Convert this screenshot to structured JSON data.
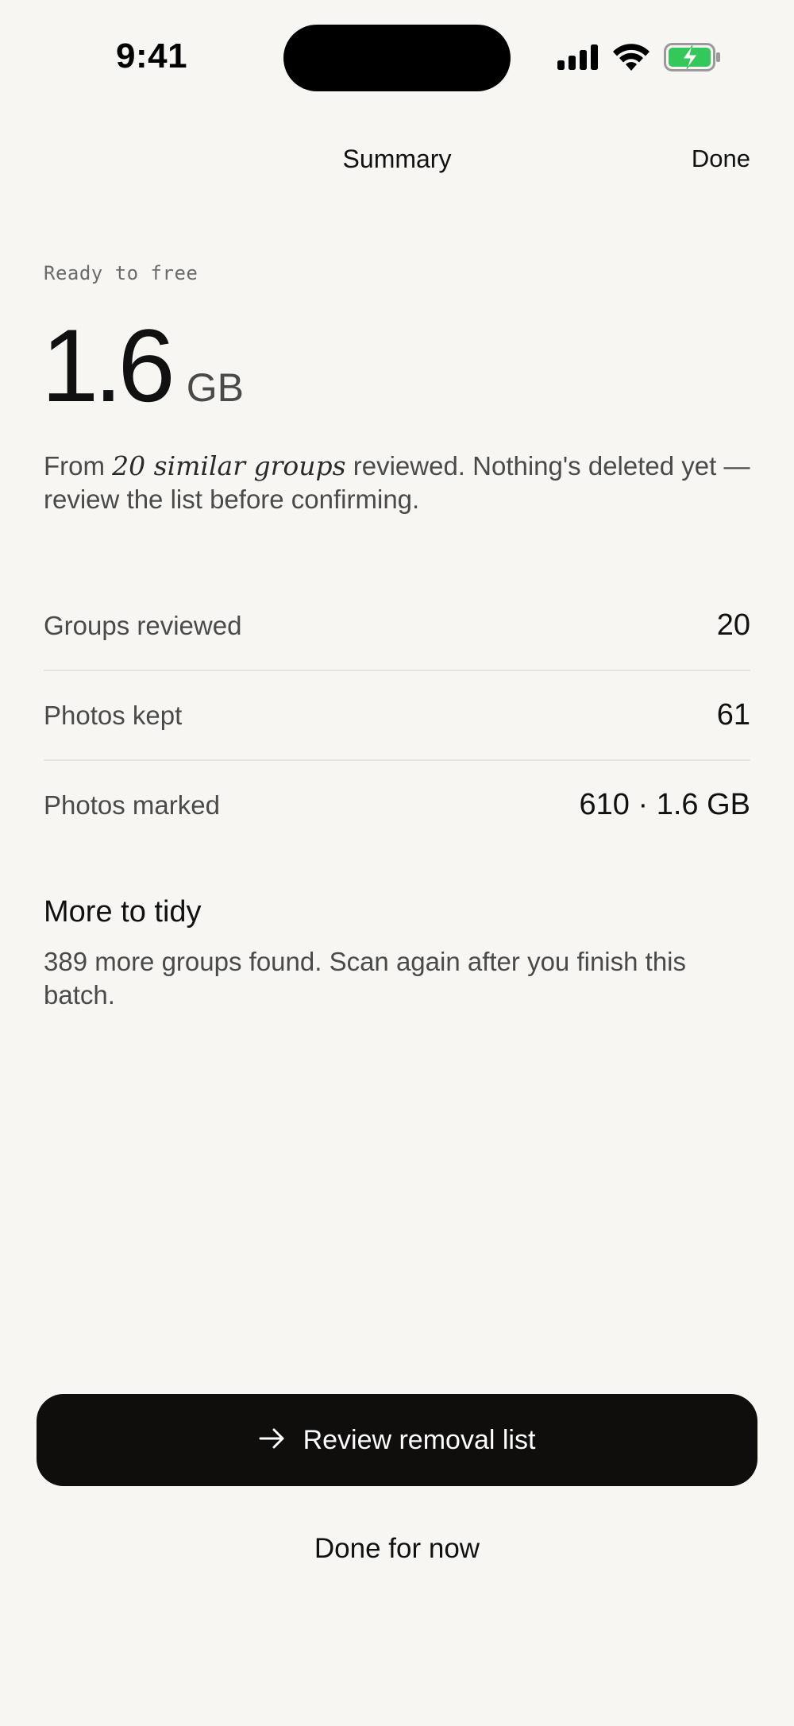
{
  "status_bar": {
    "time": "9:41",
    "icons": [
      "cellular-signal-icon",
      "wifi-icon",
      "battery-charging-icon"
    ],
    "battery_color": "#34c759"
  },
  "nav": {
    "title": "Summary",
    "done_label": "Done"
  },
  "summary": {
    "eyebrow": "Ready to free",
    "amount": "1.6",
    "unit": "GB",
    "desc_prefix": "From ",
    "desc_emphasis": "20 similar groups",
    "desc_suffix": " reviewed. Nothing's deleted yet — review the list before confirming."
  },
  "stats": [
    {
      "label": "Groups reviewed",
      "value": "20"
    },
    {
      "label": "Photos kept",
      "value": "61"
    },
    {
      "label": "Photos marked",
      "value": "610 · 1.6 GB"
    }
  ],
  "more": {
    "title": "More to tidy",
    "description": "389 more groups found. Scan again after you finish this batch."
  },
  "actions": {
    "primary_label": "Review removal list",
    "primary_icon": "arrow-right-icon",
    "secondary_label": "Done for now"
  },
  "colors": {
    "background": "#f7f6f2",
    "primary_button": "#0f0e0c",
    "muted_text": "#4a4a4a"
  }
}
